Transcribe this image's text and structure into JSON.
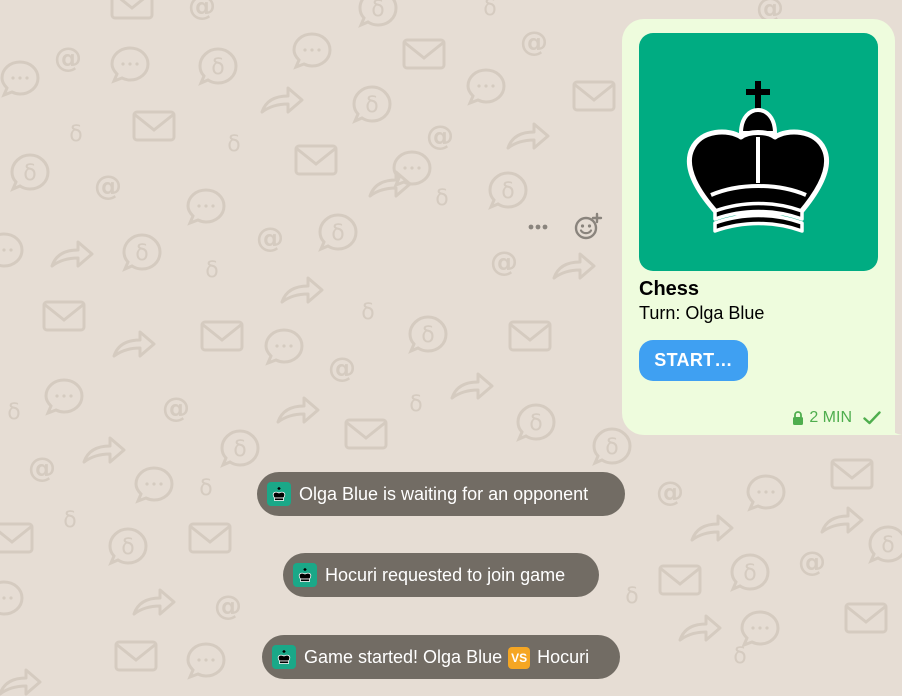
{
  "colors": {
    "chat_background": "#e6ddd4",
    "bubble_background": "#eefcdd",
    "game_image_background": "#00ac82",
    "start_button": "#3fa0f2",
    "meta_green": "#4fae4e",
    "service_message_background": "#625c54",
    "vs_badge": "#f5a623"
  },
  "message": {
    "game_title": "Chess",
    "turn_text": "Turn: Olga Blue",
    "start_button_label": "START…",
    "meta": {
      "lock_icon": "lock-icon",
      "time": "2 MIN",
      "status_icon": "check-icon"
    },
    "image_icon": "chess-king-icon"
  },
  "actions": {
    "more_icon": "more-dots-icon",
    "reaction_icon": "add-reaction-icon"
  },
  "service_messages": [
    {
      "icon": "chess-king-icon",
      "text": "Olga Blue is waiting for an opponent"
    },
    {
      "icon": "chess-king-icon",
      "text": "Hocuri requested to join game"
    },
    {
      "icon": "chess-king-icon",
      "text_before": "Game started! Olga Blue",
      "badge": "VS",
      "text_after": "Hocuri"
    }
  ]
}
